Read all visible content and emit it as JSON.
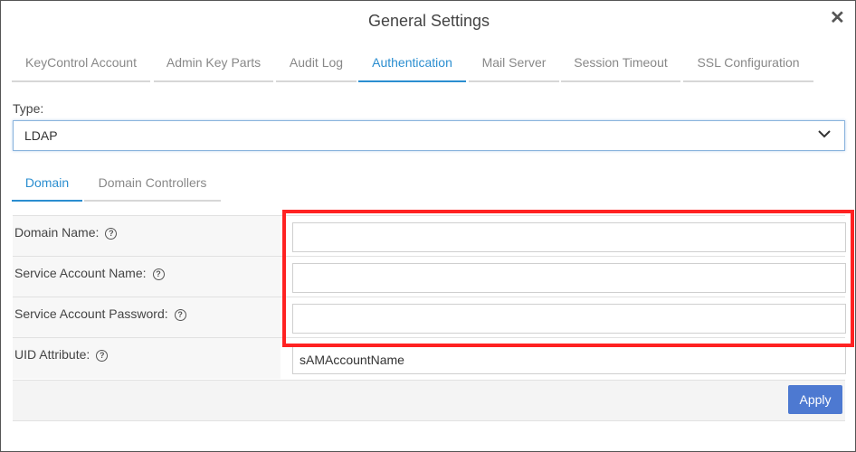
{
  "dialog": {
    "title": "General Settings",
    "close_glyph": "✕"
  },
  "tabs": [
    {
      "label": "KeyControl Account"
    },
    {
      "label": "Admin Key Parts"
    },
    {
      "label": "Audit Log"
    },
    {
      "label": "Authentication",
      "active": true
    },
    {
      "label": "Mail Server"
    },
    {
      "label": "Session Timeout"
    },
    {
      "label": "SSL Configuration"
    }
  ],
  "type_select": {
    "label": "Type:",
    "value": "LDAP"
  },
  "subtabs": [
    {
      "label": "Domain",
      "active": true
    },
    {
      "label": "Domain Controllers"
    }
  ],
  "form": {
    "domain_name": {
      "label": "Domain Name:",
      "value": ""
    },
    "service_account_name": {
      "label": "Service Account Name:",
      "value": ""
    },
    "service_account_password": {
      "label": "Service Account Password:",
      "value": ""
    },
    "uid_attribute": {
      "label": "UID Attribute:",
      "value": "sAMAccountName"
    },
    "help_glyph": "?"
  },
  "footer": {
    "apply_label": "Apply"
  },
  "colors": {
    "accent": "#2b8ed0",
    "apply_button": "#4d79d1",
    "highlight": "#ff2222"
  }
}
